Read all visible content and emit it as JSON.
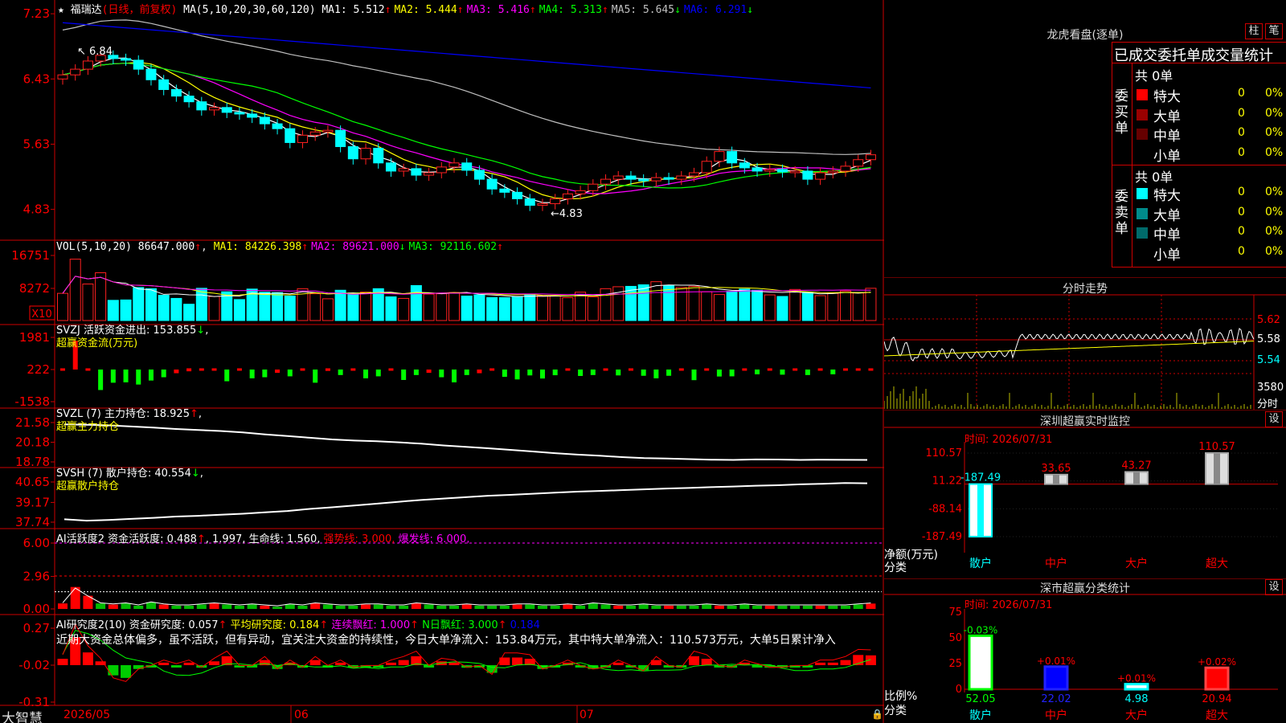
{
  "stock": {
    "name": "福瑞达",
    "period": "(日线，前复权)",
    "ma_params": "MA(5,10,20,30,60,120)",
    "ma_values": [
      {
        "label": "MA1:",
        "value": "5.512",
        "dir": "↑",
        "color": "#ffffff"
      },
      {
        "label": "MA2:",
        "value": "5.444",
        "dir": "↑",
        "color": "#ffff00"
      },
      {
        "label": "MA3:",
        "value": "5.416",
        "dir": "↑",
        "color": "#ff00ff"
      },
      {
        "label": "MA4:",
        "value": "5.313",
        "dir": "↑",
        "color": "#00ff00"
      },
      {
        "label": "MA5:",
        "value": "5.645",
        "dir": "↓",
        "color": "#c0c0c0"
      },
      {
        "label": "MA6:",
        "value": "6.291",
        "dir": "↓",
        "color": "#0000ff"
      }
    ],
    "high_mark": "6.84",
    "low_mark": "4.83"
  },
  "price_axis": [
    "7.23",
    "6.43",
    "5.63",
    "4.83"
  ],
  "vol_panel": {
    "title": "VOL(5,10,20)",
    "value": "86647.000",
    "items": [
      {
        "text": "MA1: 84226.398",
        "dir": "↑",
        "color": "#ffff00"
      },
      {
        "text": "MA2: 89621.000",
        "dir": "↓",
        "color": "#ff00ff"
      },
      {
        "text": "MA3: 92116.602",
        "dir": "↑",
        "color": "#00ff00"
      }
    ],
    "axis": [
      "16751",
      "8272"
    ],
    "unit": "X10"
  },
  "svzj_panel": {
    "title": "SVZJ  活跃资金进出: 153.855",
    "dir": "↓",
    "sub": "超赢资金流(万元)",
    "axis": [
      "1981",
      "222",
      "-1538"
    ]
  },
  "svzl_panel": {
    "title": "SVZL (7) 主力持仓: 18.925",
    "dir": "↑",
    "sub": "超赢主力持仓",
    "axis": [
      "21.58",
      "20.18",
      "18.78"
    ]
  },
  "svsh_panel": {
    "title": "SVSH (7) 散户持仓: 40.554",
    "dir": "↓",
    "sub": "超赢散户持仓",
    "axis": [
      "40.65",
      "39.17",
      "37.74"
    ]
  },
  "ai_active_panel": {
    "title_a": "AI活跃度2 资金活跃度: 0.488",
    "title_b": ", 1.997,",
    "title_c": " 生命线: 1.560,",
    "title_d": " 强势线: 3.000,",
    "title_e": " 爆发线: 6.000,",
    "axis": [
      "6.00",
      "2.96",
      "0.00"
    ]
  },
  "ai_research_panel": {
    "title_a": "AI研究度2(10) 资金研究度: 0.057",
    "title_b": " 平均研究度: 0.184",
    "title_c": " 连续飘红: 1.000",
    "title_d": " N日飘红: 3.000",
    "title_e": " 0.184",
    "comment": "近期大资金总体偏多，虽不活跃，但有异动，宜关注大资金的持续性，今日大单净流入：153.84万元，其中特大单净流入：110.573万元，大单5日累计净入",
    "axis": [
      "0.27",
      "-0.02",
      "-0.31"
    ]
  },
  "date_axis": [
    "2026/05",
    "06",
    "07"
  ],
  "brand": "大智慧",
  "right": {
    "dragon_title": "龙虎看盘(逐单)",
    "tab_zhu": "柱",
    "tab_bi": "笔",
    "stat_title": "已成交委托单成交量统计",
    "buy_side_label": "委买单",
    "sell_side_label": "委卖单",
    "buy_total": "共 0单",
    "sell_total": "共 0单",
    "buy_rows": [
      {
        "name": "特大",
        "count": "0",
        "pct": "0%",
        "color": "#ff0000"
      },
      {
        "name": "大单",
        "count": "0",
        "pct": "0%",
        "color": "#990000"
      },
      {
        "name": "中单",
        "count": "0",
        "pct": "0%",
        "color": "#660000"
      },
      {
        "name": "小单",
        "count": "0",
        "pct": "0%",
        "color": "#000000"
      }
    ],
    "sell_rows": [
      {
        "name": "特大",
        "count": "0",
        "pct": "0%",
        "color": "#00ffff"
      },
      {
        "name": "大单",
        "count": "0",
        "pct": "0%",
        "color": "#008b8b"
      },
      {
        "name": "中单",
        "count": "0",
        "pct": "0%",
        "color": "#006b6b"
      },
      {
        "name": "小单",
        "count": "0",
        "pct": "0%",
        "color": "#000000"
      }
    ],
    "intraday_title": "分时走势",
    "intraday_axis": [
      "5.62",
      "5.58",
      "5.54"
    ],
    "intraday_vol": "3580",
    "intraday_vol_unit": "分时",
    "sz_title": "深圳超赢实时监控",
    "set_label": "设",
    "sz_time": "时间: 2026/07/31",
    "sz_axis": [
      "110.57",
      "11.22",
      "-88.14",
      "-187.49"
    ],
    "sz_ylabel": "净额(万元)",
    "sz_xlabel": "分类",
    "sz_categories": [
      "散户",
      "中户",
      "大户",
      "超大"
    ],
    "sz_values": [
      "-187.49",
      "33.65",
      "43.27",
      "110.57"
    ],
    "class_title": "深市超赢分类统计",
    "class_time": "时间: 2026/07/31",
    "class_axis": [
      "75",
      "50",
      "25",
      "0"
    ],
    "class_ylabel": "比例%",
    "class_xlabel": "分类",
    "class_categories": [
      "散户",
      "中户",
      "大户",
      "超大"
    ],
    "class_values": [
      "52.05",
      "22.02",
      "4.98",
      "20.94"
    ],
    "class_changes": [
      "-0.03%",
      "+0.01%",
      "+0.01%",
      "+0.02%"
    ]
  },
  "chart_data": [
    {
      "type": "candlestick",
      "title": "福瑞达(日线，前复权)",
      "ylim": [
        4.6,
        7.3
      ],
      "x": [
        "2026/05",
        "06",
        "07"
      ],
      "close": [
        6.48,
        6.55,
        6.65,
        6.72,
        6.68,
        6.66,
        6.55,
        6.42,
        6.3,
        6.22,
        6.15,
        6.05,
        6.08,
        6.02,
        6.0,
        5.96,
        5.88,
        5.82,
        5.65,
        5.74,
        5.78,
        5.8,
        5.6,
        5.45,
        5.58,
        5.4,
        5.3,
        5.33,
        5.25,
        5.28,
        5.35,
        5.4,
        5.31,
        5.2,
        5.08,
        5.04,
        4.96,
        4.88,
        4.9,
        4.96,
        5.02,
        5.06,
        5.14,
        5.2,
        5.24,
        5.2,
        5.18,
        5.22,
        5.2,
        5.24,
        5.28,
        5.42,
        5.54,
        5.4,
        5.34,
        5.3,
        5.32,
        5.29,
        5.3,
        5.2,
        5.28,
        5.3,
        5.36,
        5.44,
        5.5
      ],
      "ma_series": [
        "MA5",
        "MA10",
        "MA20",
        "MA30",
        "MA60",
        "MA120"
      ]
    },
    {
      "type": "bar",
      "title": "VOL(5,10,20)",
      "ylim": [
        0,
        16751
      ],
      "values": [
        7000,
        15800,
        9400,
        12300,
        5200,
        5300,
        8500,
        8200,
        6500,
        5700,
        4200,
        8300,
        6200,
        7400,
        5400,
        8100,
        7300,
        7200,
        6300,
        8200,
        6900,
        5600,
        7800,
        7100,
        7300,
        8200,
        6100,
        5700,
        9000,
        6800,
        6900,
        7200,
        6300,
        6600,
        5900,
        5900,
        6200,
        6800,
        6400,
        6300,
        5900,
        7300,
        6100,
        8200,
        8700,
        8800,
        9200,
        10000,
        9000,
        8500,
        8800,
        7400,
        6700,
        7500,
        8100,
        7800,
        6600,
        6200,
        8000,
        7200,
        6400,
        7000,
        7600,
        7100,
        8300
      ]
    },
    {
      "type": "bar",
      "title": "SVZJ 活跃资金进出",
      "ylim": [
        -1538,
        1981
      ],
      "values": [
        180,
        1800,
        220,
        -900,
        -500,
        -480,
        -600,
        -380,
        -200,
        20,
        60,
        120,
        140,
        -420,
        100,
        -260,
        -200,
        40,
        -150,
        160,
        -500,
        80,
        -80,
        120,
        -260,
        -150,
        160,
        -350,
        -80,
        40,
        -200,
        -480,
        -80,
        20,
        220,
        -180,
        -320,
        -100,
        -270,
        -90,
        200,
        -130,
        -80,
        220,
        -100,
        200,
        -120,
        -260,
        -120,
        200,
        -360,
        220,
        -160,
        -150,
        110,
        -40,
        150,
        -60,
        220,
        -80,
        170,
        -40,
        200,
        200,
        153
      ]
    },
    {
      "type": "line",
      "title": "SVZL (7) 主力持仓",
      "ylim": [
        18.78,
        21.58
      ],
      "values": [
        21.45,
        21.42,
        21.38,
        21.3,
        21.22,
        21.12,
        21.05,
        20.98,
        20.88,
        20.74,
        20.62,
        20.5,
        20.38,
        20.3,
        20.25,
        20.17,
        20.08,
        19.95,
        19.85,
        19.75,
        19.64,
        19.52,
        19.4,
        19.3,
        19.22,
        19.12,
        19.05,
        19.02,
        18.98,
        18.94,
        18.92,
        18.96,
        18.95,
        18.92,
        18.94,
        18.93,
        18.925
      ]
    },
    {
      "type": "line",
      "title": "SVSH (7) 散户持仓",
      "ylim": [
        37.74,
        40.65
      ],
      "values": [
        37.95,
        37.85,
        37.9,
        37.98,
        38.05,
        38.15,
        38.2,
        38.28,
        38.35,
        38.45,
        38.55,
        38.7,
        38.82,
        38.95,
        39.08,
        39.22,
        39.35,
        39.45,
        39.55,
        39.65,
        39.72,
        39.8,
        39.88,
        39.95,
        40.0,
        40.06,
        40.12,
        40.18,
        40.22,
        40.28,
        40.32,
        40.38,
        40.42,
        40.48,
        40.52,
        40.58,
        40.554
      ]
    },
    {
      "type": "bar",
      "title": "AI活跃度2",
      "ylim": [
        0,
        6.0
      ],
      "values": [
        0.5,
        2.0,
        1.2,
        0.5,
        0.4,
        0.5,
        0.3,
        0.6,
        0.4,
        0.3,
        0.3,
        0.4,
        0.5,
        0.4,
        0.3,
        0.4,
        0.3,
        0.2,
        0.4,
        0.3,
        0.5,
        0.4,
        0.3,
        0.3,
        0.4,
        0.4,
        0.3,
        0.3,
        0.5,
        0.4,
        0.3,
        0.3,
        0.4,
        0.3,
        0.3,
        0.3,
        0.4,
        0.4,
        0.3,
        0.3,
        0.4,
        0.3,
        0.5,
        0.4,
        0.3,
        0.3,
        0.4,
        0.3,
        0.3,
        0.3,
        0.3,
        0.4,
        0.3,
        0.3,
        0.4,
        0.3,
        0.3,
        0.3,
        0.3,
        0.3,
        0.3,
        0.3,
        0.3,
        0.4,
        0.488
      ]
    },
    {
      "type": "bar",
      "title": "AI研究度2(10)",
      "ylim": [
        -0.31,
        0.27
      ],
      "values": [
        0.03,
        0.2,
        0.08,
        0.01,
        -0.1,
        -0.12,
        -0.05,
        -0.03,
        0.0,
        -0.02,
        0.0,
        -0.04,
        0.01,
        0.05,
        -0.03,
        -0.03,
        0.02,
        -0.05,
        0.0,
        -0.04,
        0.02,
        -0.03,
        0.0,
        -0.04,
        -0.03,
        -0.03,
        0.0,
        0.02,
        0.05,
        -0.03,
        0.01,
        0.0,
        -0.04,
        -0.03,
        -0.08,
        0.04,
        0.04,
        0.03,
        -0.05,
        -0.03,
        0.0,
        -0.03,
        -0.05,
        -0.04,
        0.0,
        -0.03,
        -0.06,
        0.02,
        -0.03,
        -0.04,
        0.05,
        0.03,
        -0.03,
        -0.04,
        0.0,
        -0.02,
        -0.04,
        -0.04,
        -0.03,
        -0.03,
        0.0,
        0.0,
        0.02,
        0.06,
        0.057
      ]
    },
    {
      "type": "bar",
      "title": "深圳超赢实时监控",
      "categories": [
        "散户",
        "中户",
        "大户",
        "超大"
      ],
      "values": [
        -187.49,
        33.65,
        43.27,
        110.57
      ],
      "ylim": [
        -187.49,
        110.57
      ],
      "ylabel": "净额(万元)",
      "xlabel": "分类"
    },
    {
      "type": "bar",
      "title": "深市超赢分类统计",
      "categories": [
        "散户",
        "中户",
        "大户",
        "超大"
      ],
      "values": [
        52.05,
        22.02,
        4.98,
        20.94
      ],
      "ylim": [
        0,
        75
      ],
      "ylabel": "比例%",
      "xlabel": "分类"
    }
  ]
}
